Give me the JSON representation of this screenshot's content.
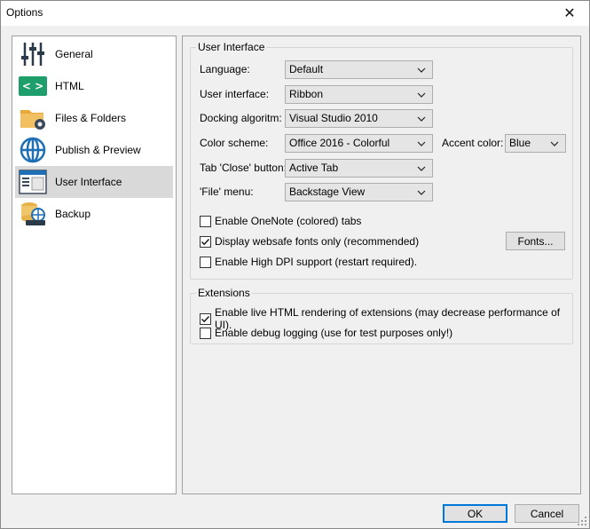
{
  "window": {
    "title": "Options",
    "close_glyph": "✕"
  },
  "nav": {
    "items": [
      {
        "label": "General",
        "icon": "sliders-icon"
      },
      {
        "label": "HTML",
        "icon": "html-icon"
      },
      {
        "label": "Files & Folders",
        "icon": "folder-gear-icon"
      },
      {
        "label": "Publish & Preview",
        "icon": "globe-icon"
      },
      {
        "label": "User Interface",
        "icon": "window-icon",
        "selected": true
      },
      {
        "label": "Backup",
        "icon": "backup-icon"
      }
    ]
  },
  "ui_group": {
    "title": "User Interface",
    "language": {
      "label": "Language:",
      "value": "Default"
    },
    "user_interface": {
      "label": "User interface:",
      "value": "Ribbon"
    },
    "docking": {
      "label": "Docking algoritm:",
      "value": "Visual Studio 2010"
    },
    "color_scheme": {
      "label": "Color scheme:",
      "value": "Office 2016 - Colorful"
    },
    "accent_color": {
      "label": "Accent color:",
      "value": "Blue"
    },
    "tab_close": {
      "label": "Tab 'Close' button:",
      "value": "Active Tab"
    },
    "file_menu": {
      "label": "'File' menu:",
      "value": "Backstage View"
    },
    "onenote_tabs": {
      "label": "Enable OneNote (colored) tabs",
      "checked": false
    },
    "websafe_fonts": {
      "label": "Display websafe fonts only (recommended)",
      "checked": true
    },
    "fonts_button": "Fonts...",
    "high_dpi": {
      "label": "Enable High DPI support (restart required).",
      "checked": false
    }
  },
  "ext_group": {
    "title": "Extensions",
    "live_html": {
      "label": "Enable live HTML rendering of extensions (may decrease performance of UI).",
      "checked": true
    },
    "debug_logging": {
      "label": "Enable debug logging (use for test purposes only!)",
      "checked": false
    }
  },
  "footer": {
    "ok_label": "OK",
    "cancel_label": "Cancel"
  },
  "colors": {
    "selected_nav_bg": "#d9d9d9",
    "accent_blue": "#0078d7"
  }
}
